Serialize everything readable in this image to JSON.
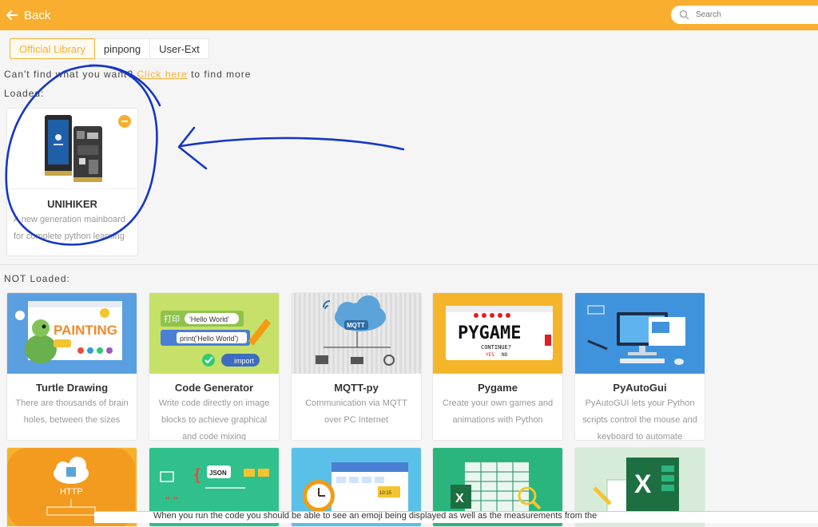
{
  "header": {
    "back_label": "Back",
    "search_placeholder": "Search"
  },
  "tabs": [
    {
      "label": "Official Library",
      "active": true
    },
    {
      "label": "pinpong",
      "active": false
    },
    {
      "label": "User-Ext",
      "active": false
    }
  ],
  "help": {
    "prefix": "Can't find what you want? ",
    "link": "Click here",
    "suffix": " to find more"
  },
  "loaded": {
    "label": "Loaded:",
    "items": [
      {
        "title": "UNIHIKER",
        "desc": "A new generation mainboard for complete python learning"
      }
    ]
  },
  "not_loaded": {
    "label": "NOT Loaded:",
    "items": [
      {
        "title": "Turtle Drawing",
        "desc": "There are thousands of brain holes, between the sizes"
      },
      {
        "title": "Code Generator",
        "desc": "Write code directly on image blocks to achieve graphical and code mixing"
      },
      {
        "title": "MQTT-py",
        "desc": "Communication via MQTT over PC Internet"
      },
      {
        "title": "Pygame",
        "desc": "Create your own games and animations with Python"
      },
      {
        "title": "PyAutoGui",
        "desc": "PyAutoGUI lets your Python scripts control the mouse and keyboard to automate"
      }
    ]
  },
  "thumb_text": {
    "turtle": "PAINTING",
    "code_hello": "'Hello World'",
    "code_print": "print('Hello World')",
    "code_dayin": "打印",
    "code_import": "import",
    "mqtt": "MQTT",
    "pygame": "PYGAME",
    "pygame_continue": "CONTINUE?",
    "pygame_yes": "YES",
    "pygame_no": "NO",
    "http": "HTTP",
    "json": "JSON",
    "clock": "10:15"
  },
  "bottom_text": "When you run the code you should be able to see an emoji being displayed as well as the measurements from the",
  "colors": {
    "accent": "#f9ae2f",
    "annotation": "#1536c4"
  }
}
